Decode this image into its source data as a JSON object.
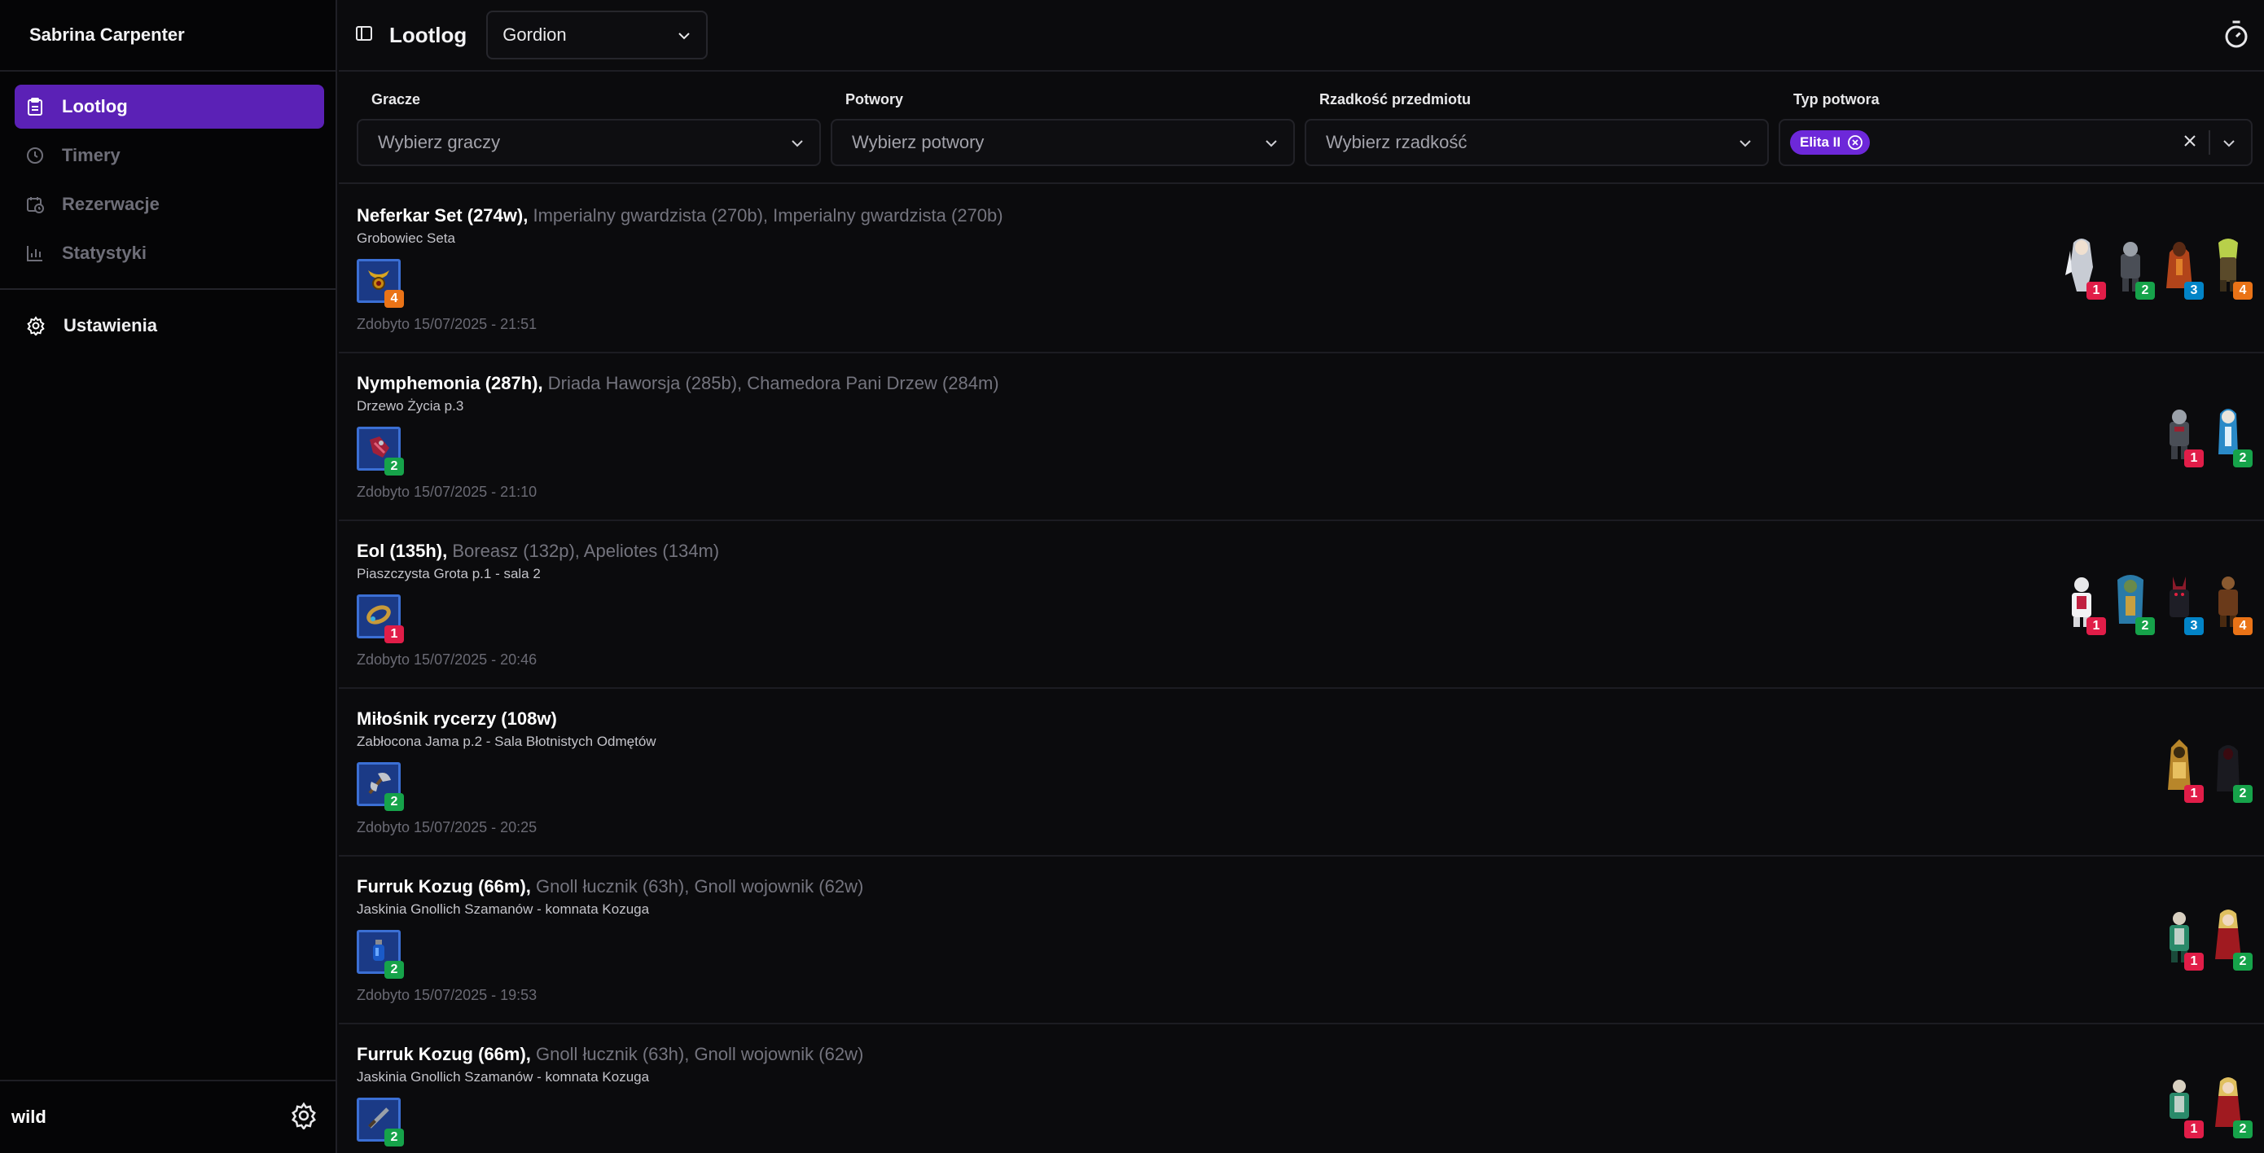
{
  "sidebar": {
    "user_name": "Sabrina Carpenter",
    "items": [
      {
        "label": "Lootlog",
        "icon": "clipboard-icon",
        "active": true
      },
      {
        "label": "Timery",
        "icon": "clock-icon",
        "active": false
      },
      {
        "label": "Rezerwacje",
        "icon": "calendar-clock-icon",
        "active": false
      },
      {
        "label": "Statystyki",
        "icon": "bar-chart-icon",
        "active": false
      }
    ],
    "settings_label": "Ustawienia",
    "footer_user": "wild"
  },
  "topbar": {
    "title": "Lootlog",
    "world": "Gordion"
  },
  "filters": {
    "players": {
      "label": "Gracze",
      "placeholder": "Wybierz graczy"
    },
    "monsters": {
      "label": "Potwory",
      "placeholder": "Wybierz potwory"
    },
    "rarity": {
      "label": "Rzadkość przedmiotu",
      "placeholder": "Wybierz rzadkość"
    },
    "monster_type": {
      "label": "Typ potwora",
      "chip": "Elita II"
    }
  },
  "entries": [
    {
      "boss": "Neferkar Set (274w),",
      "others": "Imperialny gwardzista (270b), Imperialny gwardzista (270b)",
      "location": "Grobowiec Seta",
      "item_badge": "4",
      "date": "Zdobyto 15/07/2025 - 21:51",
      "players": [
        "1",
        "2",
        "3",
        "4"
      ]
    },
    {
      "boss": "Nymphemonia (287h),",
      "others": "Driada Haworsja (285b), Chamedora Pani Drzew (284m)",
      "location": "Drzewo Życia p.3",
      "item_badge": "2",
      "date": "Zdobyto 15/07/2025 - 21:10",
      "players": [
        "1",
        "2"
      ]
    },
    {
      "boss": "Eol (135h),",
      "others": "Boreasz (132p), Apeliotes (134m)",
      "location": "Piaszczysta Grota p.1 - sala 2",
      "item_badge": "1",
      "date": "Zdobyto 15/07/2025 - 20:46",
      "players": [
        "1",
        "2",
        "3",
        "4"
      ]
    },
    {
      "boss": "Miłośnik rycerzy (108w)",
      "others": "",
      "location": "Zabłocona Jama p.2 - Sala Błotnistych Odmętów",
      "item_badge": "2",
      "date": "Zdobyto 15/07/2025 - 20:25",
      "players": [
        "1",
        "2"
      ]
    },
    {
      "boss": "Furruk Kozug (66m),",
      "others": "Gnoll łucznik (63h), Gnoll wojownik (62w)",
      "location": "Jaskinia Gnollich Szamanów - komnata Kozuga",
      "item_badge": "2",
      "date": "Zdobyto 15/07/2025 - 19:53",
      "players": [
        "1",
        "2"
      ]
    },
    {
      "boss": "Furruk Kozug (66m),",
      "others": "Gnoll łucznik (63h), Gnoll wojownik (62w)",
      "location": "Jaskinia Gnollich Szamanów - komnata Kozuga",
      "item_badge": "2",
      "date": "",
      "players": [
        "1",
        "2"
      ]
    }
  ],
  "colors": {
    "accent": "#5b21b6",
    "chip": "#6d28d9",
    "badge_1": "#e11d48",
    "badge_2": "#16a34a",
    "badge_3": "#0284c7",
    "badge_4": "#ea7317"
  }
}
